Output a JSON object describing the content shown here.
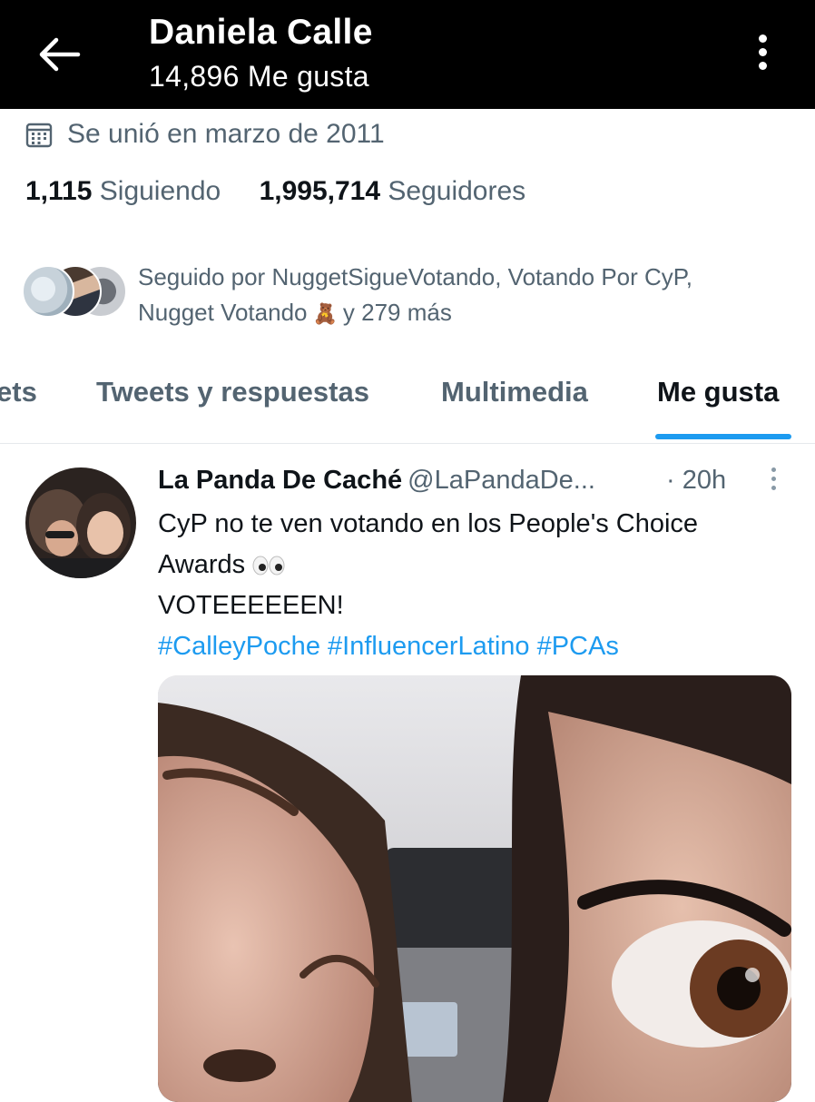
{
  "header": {
    "back_icon": "arrow-left-icon",
    "title": "Daniela Calle",
    "subtitle": "14,896 Me gusta",
    "more_icon": "more-vertical-icon"
  },
  "profile": {
    "joined_icon": "calendar-icon",
    "joined": "Se unió en marzo de 2011",
    "following_count": "1,115",
    "following_label": "Siguiendo",
    "followers_count": "1,995,714",
    "followers_label": "Seguidores",
    "followed_by_line1": "Seguido por NuggetSigueVotando, Votando Por CyP,",
    "followed_by_name3": "Nugget Votando",
    "followed_by_emoji": "🧸",
    "followed_by_more": "y 279 más"
  },
  "tabs": [
    {
      "label": "ets",
      "active": false
    },
    {
      "label": "Tweets y respuestas",
      "active": false
    },
    {
      "label": "Multimedia",
      "active": false
    },
    {
      "label": "Me gusta",
      "active": true
    }
  ],
  "tweet": {
    "author_name": "La Panda De Caché",
    "author_handle": "@LaPandaDe...",
    "time": "· 20h",
    "text_line1": "CyP no te ven votando en los People's Choice",
    "text_line2": "Awards",
    "text_line3": "VOTEEEEEEN!",
    "hashtags": [
      "#CalleyPoche",
      "#InfluencerLatino",
      "#PCAs"
    ]
  },
  "colors": {
    "accent": "#1d9bf0",
    "topbar": "#000000",
    "muted_text": "#536471"
  }
}
